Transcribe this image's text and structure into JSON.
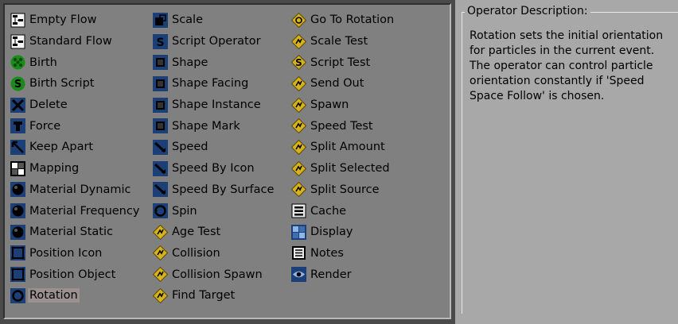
{
  "operators": {
    "column1": [
      {
        "label": "Empty Flow",
        "icon": "flow-icon"
      },
      {
        "label": "Standard Flow",
        "icon": "flow-icon"
      },
      {
        "label": "Birth",
        "icon": "birth-icon"
      },
      {
        "label": "Birth Script",
        "icon": "birth-script-icon"
      },
      {
        "label": "Delete",
        "icon": "delete-icon"
      },
      {
        "label": "Force",
        "icon": "force-icon"
      },
      {
        "label": "Keep Apart",
        "icon": "keep-apart-icon"
      },
      {
        "label": "Mapping",
        "icon": "mapping-icon"
      },
      {
        "label": "Material Dynamic",
        "icon": "material-icon"
      },
      {
        "label": "Material Frequency",
        "icon": "material-icon"
      },
      {
        "label": "Material Static",
        "icon": "material-icon"
      },
      {
        "label": "Position Icon",
        "icon": "position-icon"
      },
      {
        "label": "Position Object",
        "icon": "position-icon"
      },
      {
        "label": "Rotation",
        "icon": "rotation-icon",
        "selected": true
      }
    ],
    "column2": [
      {
        "label": "Scale",
        "icon": "scale-icon"
      },
      {
        "label": "Script Operator",
        "icon": "script-icon"
      },
      {
        "label": "Shape",
        "icon": "shape-icon"
      },
      {
        "label": "Shape Facing",
        "icon": "shape-icon"
      },
      {
        "label": "Shape Instance",
        "icon": "shape-icon"
      },
      {
        "label": "Shape Mark",
        "icon": "shape-icon"
      },
      {
        "label": "Speed",
        "icon": "speed-icon"
      },
      {
        "label": "Speed By Icon",
        "icon": "speed-icon"
      },
      {
        "label": "Speed By Surface",
        "icon": "speed-icon"
      },
      {
        "label": "Spin",
        "icon": "spin-icon"
      },
      {
        "label": "Age Test",
        "icon": "test-icon"
      },
      {
        "label": "Collision",
        "icon": "test-icon"
      },
      {
        "label": "Collision Spawn",
        "icon": "test-icon"
      },
      {
        "label": "Find Target",
        "icon": "test-icon"
      }
    ],
    "column3": [
      {
        "label": "Go To Rotation",
        "icon": "go-to-rotation-icon"
      },
      {
        "label": "Scale Test",
        "icon": "test-icon"
      },
      {
        "label": "Script Test",
        "icon": "script-test-icon"
      },
      {
        "label": "Send Out",
        "icon": "test-icon"
      },
      {
        "label": "Spawn",
        "icon": "test-icon"
      },
      {
        "label": "Speed Test",
        "icon": "test-icon"
      },
      {
        "label": "Split Amount",
        "icon": "test-icon"
      },
      {
        "label": "Split Selected",
        "icon": "test-icon"
      },
      {
        "label": "Split Source",
        "icon": "test-icon"
      },
      {
        "label": "Cache",
        "icon": "cache-icon"
      },
      {
        "label": "Display",
        "icon": "display-icon"
      },
      {
        "label": "Notes",
        "icon": "notes-icon"
      },
      {
        "label": "Render",
        "icon": "render-icon"
      }
    ]
  },
  "description": {
    "legend": "Operator Description:",
    "text": "Rotation sets the initial orientation for particles in the  current event. The operator can control particle orientation constantly if 'Speed Space Follow' is chosen."
  }
}
